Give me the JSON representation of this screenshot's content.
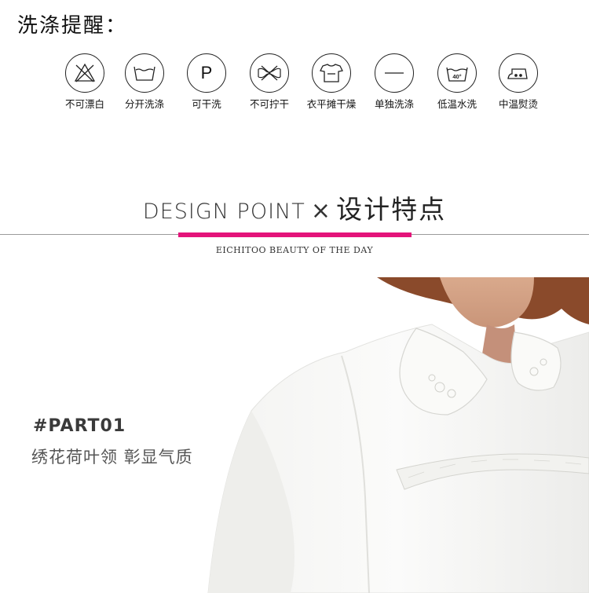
{
  "care": {
    "title": "洗涤提醒：",
    "items": [
      {
        "label": "不可漂白",
        "icon": "no-bleach-icon"
      },
      {
        "label": "分开洗涤",
        "icon": "wash-separately-icon"
      },
      {
        "label": "可干洗",
        "icon": "dry-clean-p-icon",
        "glyph": "P"
      },
      {
        "label": "不可拧干",
        "icon": "do-not-wring-icon"
      },
      {
        "label": "衣平摊干燥",
        "icon": "dry-flat-icon"
      },
      {
        "label": "单独洗涤",
        "icon": "wash-alone-icon"
      },
      {
        "label": "低温水洗",
        "icon": "low-temp-wash-icon",
        "glyph": "40°"
      },
      {
        "label": "中温熨烫",
        "icon": "medium-iron-icon"
      }
    ]
  },
  "design": {
    "title_en": "DESIGN POINT",
    "title_x": "×",
    "title_cn": "设计特点",
    "tagline": "EICHITOO  BEAUTY OF THE DAY",
    "accent_color": "#e4137a"
  },
  "part": {
    "code": "#PART01",
    "description": "绣花荷叶领  彰显气质"
  }
}
